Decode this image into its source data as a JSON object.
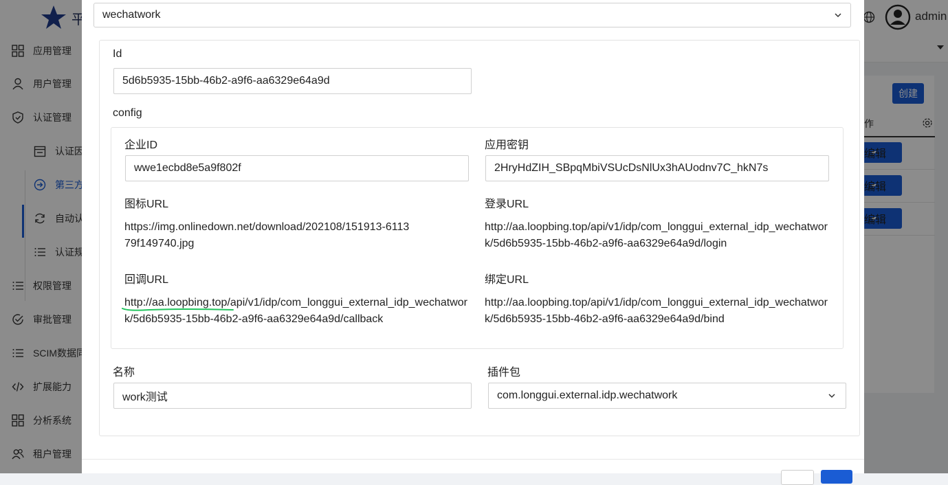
{
  "app": {
    "logo_text": "平",
    "user_name": "admin"
  },
  "sidebar": {
    "items": [
      {
        "label": "应用管理",
        "icon": "grid-icon"
      },
      {
        "label": "用户管理",
        "icon": "user-icon"
      },
      {
        "label": "认证管理",
        "icon": "shield-icon"
      },
      {
        "label": "认证因",
        "icon": "calendar-icon"
      },
      {
        "label": "第三方",
        "icon": "arrow-circle-icon"
      },
      {
        "label": "自动认",
        "icon": "refresh-icon"
      },
      {
        "label": "认证规",
        "icon": "list-icon"
      },
      {
        "label": "权限管理",
        "icon": "list-icon"
      },
      {
        "label": "审批管理",
        "icon": "check-circle-icon"
      },
      {
        "label": "SCIM数据同",
        "icon": "list-icon"
      },
      {
        "label": "扩展能力",
        "icon": "code-icon"
      },
      {
        "label": "分析系统",
        "icon": "grid-icon"
      },
      {
        "label": "租户管理",
        "icon": "users-icon"
      }
    ]
  },
  "main": {
    "create_label": "创建",
    "column_header": "作",
    "edit_label": "编辑"
  },
  "modal": {
    "type_select_value": "wechatwork",
    "id_label": "Id",
    "id_value": "5d6b5935-15bb-46b2-a9f6-aa6329e64a9d",
    "config_label": "config",
    "config": {
      "corp_id_label": "企业ID",
      "corp_id_value": "wwe1ecbd8e5a9f802f",
      "secret_label": "应用密钥",
      "secret_value": "2HryHdZIH_SBpqMbiVSUcDsNlUx3hAUodnv7C_hkN7s",
      "icon_url_label": "图标URL",
      "icon_url_value": "https://img.onlinedown.net/download/202108/151913-611379f149740.jpg",
      "login_url_label": "登录URL",
      "login_url_value": "http://aa.loopbing.top/api/v1/idp/com_longgui_external_idp_wechatwork/5d6b5935-15bb-46b2-a9f6-aa6329e64a9d/login",
      "callback_url_label": "回调URL",
      "callback_url_value": "http://aa.loopbing.top/api/v1/idp/com_longgui_external_idp_wechatwork/5d6b5935-15bb-46b2-a9f6-aa6329e64a9d/callback",
      "bind_url_label": "绑定URL",
      "bind_url_value": "http://aa.loopbing.top/api/v1/idp/com_longgui_external_idp_wechatwork/5d6b5935-15bb-46b2-a9f6-aa6329e64a9d/bind"
    },
    "name_label": "名称",
    "name_value": "work测试",
    "package_label": "插件包",
    "package_value": "com.longgui.external.idp.wechatwork"
  },
  "colors": {
    "accent": "#1a5cd4",
    "highlight_stroke": "#22c55e"
  }
}
